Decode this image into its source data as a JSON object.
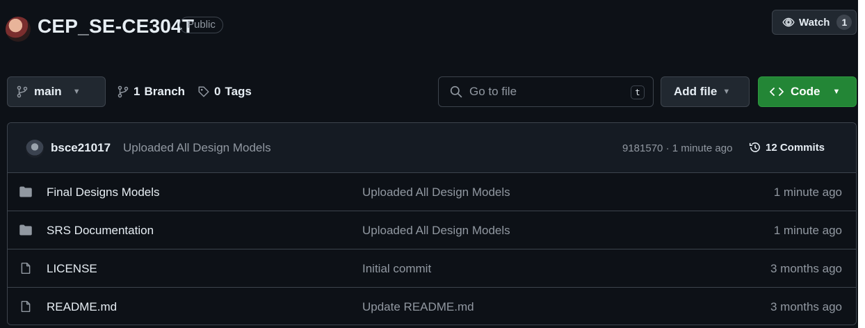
{
  "repo": {
    "name": "CEP_SE-CE304T",
    "visibility": "Public",
    "watch_label": "Watch",
    "watch_count": "1"
  },
  "toolbar": {
    "branch": "main",
    "branch_count": "1",
    "branch_word": "Branch",
    "tag_count": "0",
    "tag_word": "Tags",
    "search_placeholder": "Go to file",
    "search_shortcut": "t",
    "add_file_label": "Add file",
    "code_label": "Code"
  },
  "latest_commit": {
    "author": "bsce21017",
    "message": "Uploaded All Design Models",
    "hash_time": "9181570 · 1 minute ago",
    "commits_label": "12 Commits"
  },
  "files": [
    {
      "name": "Final Designs Models",
      "type": "folder",
      "commit": "Uploaded All Design Models",
      "date": "1 minute ago"
    },
    {
      "name": "SRS Documentation",
      "type": "folder",
      "commit": "Uploaded All Design Models",
      "date": "1 minute ago"
    },
    {
      "name": "LICENSE",
      "type": "file",
      "commit": "Initial commit",
      "date": "3 months ago"
    },
    {
      "name": "README.md",
      "type": "file",
      "commit": "Update README.md",
      "date": "3 months ago"
    }
  ],
  "icons": {
    "owner_avatar": "avatar",
    "watch": "eye-icon",
    "branch": "git-branch-icon",
    "tag": "tag-icon",
    "search": "search-icon",
    "code": "code-icon",
    "history": "history-icon",
    "folder": "folder-icon",
    "file": "file-icon"
  },
  "colors": {
    "background": "#0d1117",
    "border": "#3d444d",
    "primary_button": "#238636",
    "text": "#e6edf3",
    "muted": "#9198a1"
  }
}
